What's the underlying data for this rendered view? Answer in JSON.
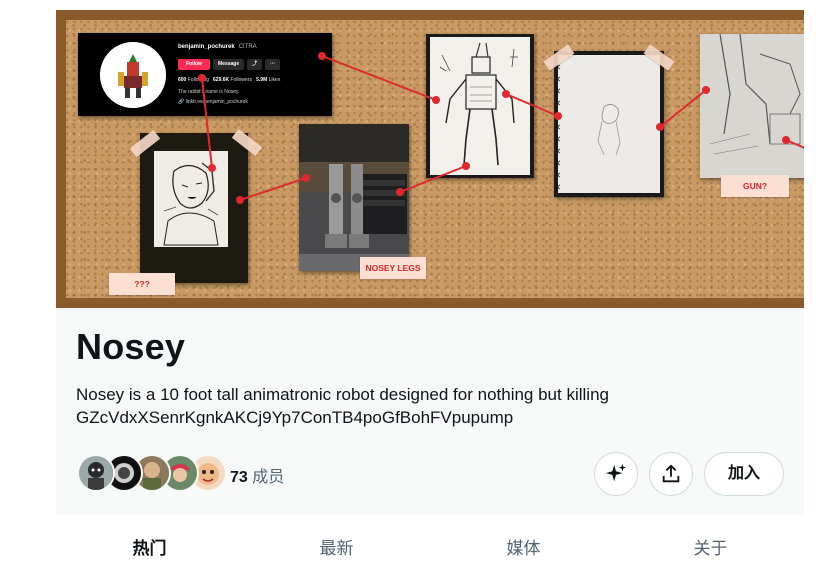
{
  "banner": {
    "profile": {
      "username": "benjamin_pochurek",
      "tag": "CITRA",
      "follow_label": "Follow",
      "message_label": "Message",
      "stats": [
        {
          "value": "600",
          "label": "Following"
        },
        {
          "value": "629.6K",
          "label": "Followers"
        },
        {
          "value": "5.9M",
          "label": "Likes"
        }
      ],
      "bio": "The rabbit's name is Nosey.",
      "link": "linktr.ee/benjamin_pochurek"
    },
    "labels": {
      "unknown": "???",
      "legs": "NOSEY LEGS",
      "gun": "GUN?"
    },
    "colors": {
      "frame": "#8a5a2b",
      "cork": "#c99a64",
      "thread": "#e0282e",
      "label_bg": "#fadfd2",
      "label_text": "#d7262a"
    }
  },
  "community": {
    "name": "Nosey",
    "description_line1": "Nosey is a 10 foot tall animatronic robot designed for nothing but killing",
    "description_line2": "GZcVdxXSenrKgnkAKCj9Yp7ConTB4poGfBohFVpupump",
    "member_count": "73",
    "member_label": "成员",
    "join_label": "加入",
    "spark_icon": "sparkle-icon",
    "share_icon": "share-upload-icon"
  },
  "tabs": [
    {
      "label": "热门",
      "active": true
    },
    {
      "label": "最新",
      "active": false
    },
    {
      "label": "媒体",
      "active": false
    },
    {
      "label": "关于",
      "active": false
    }
  ]
}
